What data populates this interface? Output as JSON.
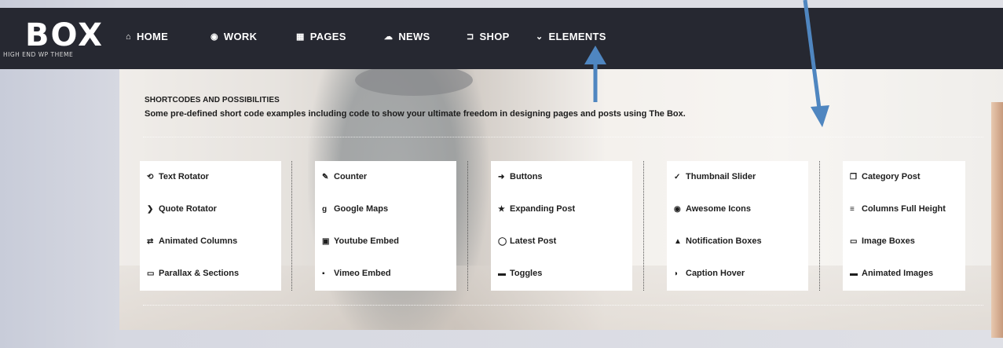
{
  "brand": {
    "logo": "BOX",
    "tagline": "HIGH END WP THEME"
  },
  "nav": [
    {
      "icon": "home-icon",
      "glyph": "⌂",
      "label": "HOME"
    },
    {
      "icon": "circle-dot-icon",
      "glyph": "◉",
      "label": "WORK"
    },
    {
      "icon": "grid-icon",
      "glyph": "▦",
      "label": "PAGES"
    },
    {
      "icon": "chat-icon",
      "glyph": "☁",
      "label": "NEWS"
    },
    {
      "icon": "cart-icon",
      "glyph": "⊐",
      "label": "SHOP"
    },
    {
      "icon": "chevron-down-icon",
      "glyph": "⌄",
      "label": "ELEMENTS"
    }
  ],
  "section": {
    "heading": "SHORTCODES AND POSSIBILITIES",
    "subheading": "Some pre-defined short code examples including code to show your ultimate freedom in designing pages and posts using The Box."
  },
  "cards": [
    {
      "items": [
        {
          "icon": "search-rotate-icon",
          "glyph": "⟲",
          "label": "Text Rotator"
        },
        {
          "icon": "chevron-circle-icon",
          "glyph": "❯",
          "label": "Quote Rotator"
        },
        {
          "icon": "exchange-icon",
          "glyph": "⇄",
          "label": "Animated Columns"
        },
        {
          "icon": "laptop-icon",
          "glyph": "▭",
          "label": "Parallax & Sections"
        }
      ]
    },
    {
      "items": [
        {
          "icon": "wrench-icon",
          "glyph": "✎",
          "label": "Counter"
        },
        {
          "icon": "google-icon",
          "glyph": "g",
          "label": "Google Maps"
        },
        {
          "icon": "youtube-icon",
          "glyph": "▣",
          "label": "Youtube Embed"
        },
        {
          "icon": "vimeo-icon",
          "glyph": "▪",
          "label": "Vimeo Embed"
        }
      ]
    },
    {
      "items": [
        {
          "icon": "arrow-circle-icon",
          "glyph": "➜",
          "label": "Buttons"
        },
        {
          "icon": "star-icon",
          "glyph": "★",
          "label": "Expanding Post"
        },
        {
          "icon": "comment-icon",
          "glyph": "◯",
          "label": "Latest Post"
        },
        {
          "icon": "briefcase-icon",
          "glyph": "▬",
          "label": "Toggles"
        }
      ]
    },
    {
      "items": [
        {
          "icon": "thumbs-up-icon",
          "glyph": "✓",
          "label": "Thumbnail Slider"
        },
        {
          "icon": "eye-icon",
          "glyph": "◉",
          "label": "Awesome Icons"
        },
        {
          "icon": "warning-icon",
          "glyph": "▲",
          "label": "Notification Boxes"
        },
        {
          "icon": "shield-icon",
          "glyph": "◗",
          "label": "Caption Hover"
        }
      ]
    },
    {
      "items": [
        {
          "icon": "copy-icon",
          "glyph": "❐",
          "label": "Category Post"
        },
        {
          "icon": "list-icon",
          "glyph": "≡",
          "label": "Columns Full Height"
        },
        {
          "icon": "desktop-icon",
          "glyph": "▭",
          "label": "Image Boxes"
        },
        {
          "icon": "coffee-icon",
          "glyph": "▬",
          "label": "Animated Images"
        }
      ]
    }
  ],
  "colors": {
    "topbar": "#262831",
    "nav_text": "#ffffff",
    "annotation_arrow": "#4f86c0",
    "card_bg": "#ffffff"
  }
}
